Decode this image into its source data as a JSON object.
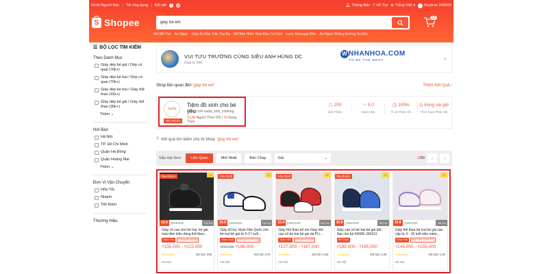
{
  "topbar": {
    "seller": "Kênh Người Bán",
    "download": "Tải ứng dụng",
    "connect": "Kết nối",
    "notifications": "Thông Báo",
    "help": "Hỗ Trợ",
    "language": "Tiếng Việt",
    "username": "thuytran 040698"
  },
  "header": {
    "logo": "Shopee",
    "search_value": "giày trẻ em",
    "cart_count": "10",
    "suggestions": [
      "Nồi Mỗ Trai",
      "Áo Ngực",
      "Giày Ấn Đầu Trắc Top Đa",
      "Mũ Bảo Hiểm Nửa Đầu Có Kính",
      "Lược Massage Đầu",
      "Áo Ngực Không Đường Su Đúc"
    ]
  },
  "sidebar": {
    "title": "BỘ LỌC TÌM KIẾM",
    "category_head": "Theo Danh Mục",
    "categories": [
      "Giày dép bé gái / Dép có quai (76k+)",
      "Giày dép bé trai / Dép có quai (70k+)",
      "Giày dép bé trai / Giày thể thao (41k+)",
      "Giày dép bé gái / Giày thể thao (35k+)"
    ],
    "more": "Thêm",
    "location_head": "Nơi Bán",
    "locations": [
      "Hà Nội",
      "TP. Hồ Chí Minh",
      "Quận Hà Đông",
      "Quận Hoàng Mai"
    ],
    "more2": "Thêm",
    "shipping_head": "Đơn Vị Vận Chuyển",
    "shipping": [
      "Hỏa Tốc",
      "Nhanh",
      "Tiết Kiệm"
    ],
    "brand_head": "Thương Hiệu"
  },
  "ad": {
    "title": "VUI TỰU TRƯỜNG CÙNG SIÊU ANH HÙNG DC",
    "sub": "Deal từ 99K",
    "brand": "NHANHOA.COM",
    "brand_sub": "TO BE THE BEST"
  },
  "shop_section": {
    "label": "Shop liên quan đến ",
    "query": "'giày trẻ em'",
    "more": "Thêm Kết Quả"
  },
  "shop": {
    "logo_text": "Sadia",
    "fav": "Yêu Thích+",
    "name": "Tiệm đồ xinh cho bé yêu",
    "sponsor": "Tài trợ bởi sadia_kids_clothing",
    "followers": "31,8k",
    "followers_label": "Người Theo Dõi",
    "following": "15",
    "following_label": "Đang Theo",
    "metrics": [
      {
        "value": "200",
        "label": "Sản Phẩm",
        "icon": "box-icon"
      },
      {
        "value": "5.0",
        "label": "Đánh Giá",
        "icon": "star-icon"
      },
      {
        "value": "100%",
        "label": "Tỉ Lệ Phản Hồi",
        "icon": "chat-icon"
      },
      {
        "value": "trong vài giờ",
        "label": "Thời Gian Phản Hồi",
        "icon": "clock-icon"
      }
    ]
  },
  "results": {
    "prefix": "Kết quả tìm kiếm cho từ khoá ",
    "query": "'giày trẻ em'"
  },
  "sort": {
    "label": "Sắp xếp theo",
    "options": [
      "Liên Quan",
      "Mới Nhất",
      "Bán Chạy"
    ],
    "price": "Giá",
    "page": "1",
    "total": "/50"
  },
  "products": [
    {
      "tag": "Yêu thích+",
      "date": "15.8",
      "ad": "Tài Trợ",
      "title": "Giày cổ cao cho bé trai, bé gái màu đen kiểu dáng thể thao...",
      "badges": [
        "Giảm ₫5k",
        "#ShopeeDaoBat"
      ],
      "old": "",
      "price": "₫135.000 - ₫215.000",
      "sold": "Đã bán 308",
      "loc": "Hà Nội"
    },
    {
      "tag": "Yêu thích",
      "date": "15.8",
      "ad": "Tài Trợ",
      "title": "Giày đi học Style Hàn Quốc cho bé trai bé gái từ 5-17 tuổi...",
      "badges": [
        "Giảm ₫10k",
        "#ShopeeTuHuong"
      ],
      "old": "₫260.000",
      "price": "₫196.000",
      "sold": "Đã bán 476",
      "loc": "Hà Nội"
    },
    {
      "tag": "Yêu thích",
      "date": "15.8",
      "ad": "Tài Trợ",
      "title": "Giày thể thao trẻ em Giày bốt cao cổ bé trai bé gái da PU...",
      "badges": [
        "Giảm ₫5k",
        "#ShopeeDaoBat"
      ],
      "old": "",
      "price": "₫127.000 - ₫167.000",
      "sold": "Đã bán 3,5k",
      "loc": "Hà Nội"
    },
    {
      "tag": "Yêu thích+",
      "date": "15.8",
      "ad": "Tài Trợ",
      "title": "Giày cao cổ bé trai bé gái bốt đẹp cho bé KIKHE J04151",
      "badges": [
        "8% Giảm"
      ],
      "old": "",
      "price": "₫189.000 - ₫195.000",
      "sold": "Đã bán 2,8k",
      "loc": "Hà Nội"
    },
    {
      "tag": "",
      "date": "15.8",
      "ad": "Tài Trợ",
      "title": "Giày thể thao bé trai bé gái cao cấp từ 3 - 16 tuổi siêu mềm...",
      "badges": [
        "Giảm ₫5k",
        "Mua Kèm Deal Sốc"
      ],
      "old": "",
      "price": "₫145.000 - ₫155.000",
      "sold": "Đã bán 2,9k",
      "loc": "Hà Nội"
    }
  ]
}
